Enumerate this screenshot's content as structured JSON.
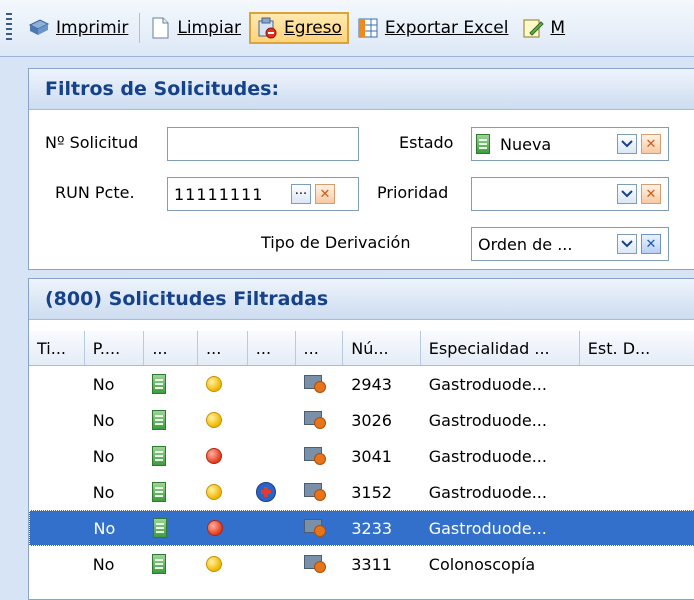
{
  "toolbar": {
    "buttons": [
      {
        "label": "Imprimir",
        "icon": "printer-icon"
      },
      {
        "label": "Limpiar",
        "icon": "blank-page-icon"
      },
      {
        "label": "Egreso",
        "icon": "egress-icon",
        "active": true
      },
      {
        "label": "Exportar Excel",
        "icon": "excel-icon"
      },
      {
        "label": "M",
        "icon": "edit-icon"
      }
    ]
  },
  "filters": {
    "title": "Filtros de Solicitudes:",
    "nro_solicitud_label": "Nº Solicitud",
    "nro_solicitud_value": "",
    "estado_label": "Estado",
    "estado_value": "Nueva",
    "run_label": "RUN Pcte.",
    "run_value": "11111111",
    "prioridad_label": "Prioridad",
    "prioridad_value": "",
    "tipo_derivacion_label": "Tipo de Derivación",
    "tipo_derivacion_value": "Orden de ..."
  },
  "results": {
    "title": "(800) Solicitudes Filtradas",
    "columns": [
      "Ti...",
      "P....",
      "...",
      "...",
      "...",
      "...",
      "Nú...",
      "Especialidad ...",
      "Est. D..."
    ],
    "rows": [
      {
        "prioridad": "No",
        "status_dot": "yellow",
        "plus": false,
        "numero": "3026",
        "especialidad": "Gastroduode..."
      },
      {
        "prioridad": "No",
        "status_dot": "yellow",
        "plus": false,
        "numero": "2943",
        "especialidad": "Gastroduode..."
      },
      {
        "prioridad": "No",
        "status_dot": "red",
        "plus": false,
        "numero": "3041",
        "especialidad": "Gastroduode..."
      },
      {
        "prioridad": "No",
        "status_dot": "yellow",
        "plus": true,
        "numero": "3152",
        "especialidad": "Gastroduode..."
      },
      {
        "prioridad": "No",
        "status_dot": "red",
        "plus": false,
        "numero": "3233",
        "especialidad": "Gastroduode...",
        "selected": true
      },
      {
        "prioridad": "No",
        "status_dot": "yellow",
        "plus": false,
        "numero": "3311",
        "especialidad": "Colonoscopía"
      }
    ]
  },
  "colors": {
    "selection": "#3370cc",
    "header_text": "#15428b",
    "background": "#d6e4f5"
  }
}
